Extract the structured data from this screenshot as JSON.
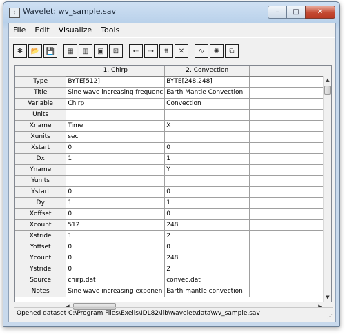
{
  "window": {
    "title": "Wavelet: wv_sample.sav",
    "app_icon": "idl-icon",
    "controls": {
      "minimize": "–",
      "maximize": "□",
      "close": "✕"
    }
  },
  "menubar": {
    "items": [
      "File",
      "Edit",
      "Visualize",
      "Tools"
    ]
  },
  "toolbar": {
    "groups": [
      [
        {
          "icon": "new-file-icon",
          "glyph": "✱"
        },
        {
          "icon": "open-folder-icon",
          "glyph": "📂"
        },
        {
          "icon": "save-disk-icon",
          "glyph": "💾"
        }
      ],
      [
        {
          "icon": "wavelet-analysis-icon",
          "glyph": "▦"
        },
        {
          "icon": "cross-wavelet-icon",
          "glyph": "▥"
        },
        {
          "icon": "variable-tile-icon",
          "glyph": "▣"
        },
        {
          "icon": "data-plot-icon",
          "glyph": "⊡"
        }
      ],
      [
        {
          "icon": "move-left-icon",
          "glyph": "⇠"
        },
        {
          "icon": "move-right-icon",
          "glyph": "⇢"
        },
        {
          "icon": "filter-icon",
          "glyph": "⩩"
        },
        {
          "icon": "delete-x-icon",
          "glyph": "✕"
        }
      ],
      [
        {
          "icon": "waveform-icon",
          "glyph": "∿"
        },
        {
          "icon": "wavelet-spectrum-icon",
          "glyph": "✺"
        },
        {
          "icon": "tree-hierarchy-icon",
          "glyph": "⧉"
        }
      ]
    ]
  },
  "grid": {
    "columns": [
      "1. Chirp",
      "2. Convection",
      ""
    ],
    "rows": [
      {
        "label": "Type",
        "values": [
          "BYTE[512]",
          "BYTE[248,248]",
          ""
        ]
      },
      {
        "label": "Title",
        "values": [
          "Sine wave increasing frequenc",
          "Earth Mantle Convection",
          ""
        ]
      },
      {
        "label": "Variable",
        "values": [
          "Chirp",
          "Convection",
          ""
        ]
      },
      {
        "label": "Units",
        "values": [
          "",
          "",
          ""
        ]
      },
      {
        "label": "Xname",
        "values": [
          "Time",
          "X",
          ""
        ]
      },
      {
        "label": "Xunits",
        "values": [
          "sec",
          "",
          ""
        ]
      },
      {
        "label": "Xstart",
        "values": [
          "0",
          "0",
          ""
        ]
      },
      {
        "label": "Dx",
        "values": [
          "1",
          "1",
          ""
        ]
      },
      {
        "label": "Yname",
        "values": [
          "",
          "Y",
          ""
        ]
      },
      {
        "label": "Yunits",
        "values": [
          "",
          "",
          ""
        ]
      },
      {
        "label": "Ystart",
        "values": [
          "0",
          "0",
          ""
        ]
      },
      {
        "label": "Dy",
        "values": [
          "1",
          "1",
          ""
        ]
      },
      {
        "label": "Xoffset",
        "values": [
          "0",
          "0",
          ""
        ]
      },
      {
        "label": "Xcount",
        "values": [
          "512",
          "248",
          ""
        ]
      },
      {
        "label": "Xstride",
        "values": [
          "1",
          "2",
          ""
        ]
      },
      {
        "label": "Yoffset",
        "values": [
          "0",
          "0",
          ""
        ]
      },
      {
        "label": "Ycount",
        "values": [
          "0",
          "248",
          ""
        ]
      },
      {
        "label": "Ystride",
        "values": [
          "0",
          "2",
          ""
        ]
      },
      {
        "label": "Source",
        "values": [
          "chirp.dat",
          "convec.dat",
          ""
        ]
      },
      {
        "label": "Notes",
        "values": [
          "Sine wave increasing exponen",
          "Earth mantle convection",
          ""
        ]
      }
    ]
  },
  "status": {
    "text": "Opened dataset C:\\Program Files\\Exelis\\IDL82\\lib\\wavelet\\data\\wv_sample.sav"
  }
}
